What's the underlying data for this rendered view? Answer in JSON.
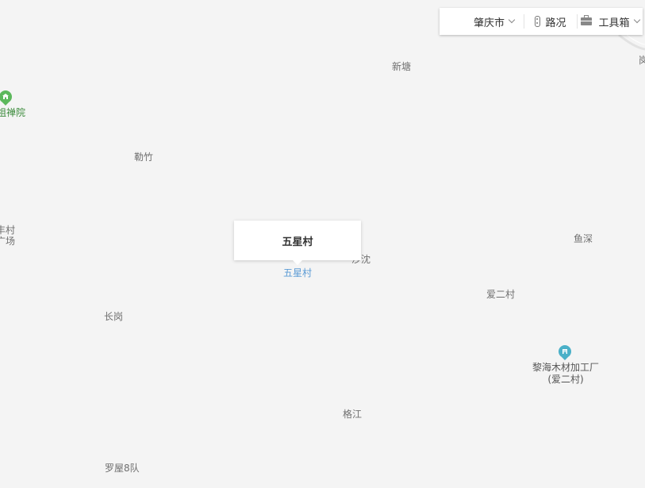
{
  "toolbar": {
    "city": "肇庆市",
    "traffic": "路况",
    "tools": "工具箱"
  },
  "popup": {
    "title": "五星村",
    "selected_label": "五星村"
  },
  "places": {
    "xintang": "新塘",
    "lezhu": "勒竹",
    "shashen": "沙沈",
    "yushen": "鱼深",
    "aiercun": "爱二村",
    "changgang": "长岗",
    "gejiang": "格江",
    "luowu": "罗屋8队",
    "cut_village": "丰村",
    "cut_square": "广场",
    "cut_right_top": "岗"
  },
  "pois": {
    "temple": {
      "name": "祖禅院",
      "icon": "temple-icon",
      "color": "#5cb85c"
    },
    "factory": {
      "name_line1": "黎海木材加工厂",
      "name_line2": "(爱二村)",
      "icon": "factory-icon",
      "color": "#4ab0c8"
    }
  },
  "colors": {
    "map_bg": "#f4f4f4",
    "place_label": "#6f6f6f",
    "selected": "#5b9bd5"
  }
}
